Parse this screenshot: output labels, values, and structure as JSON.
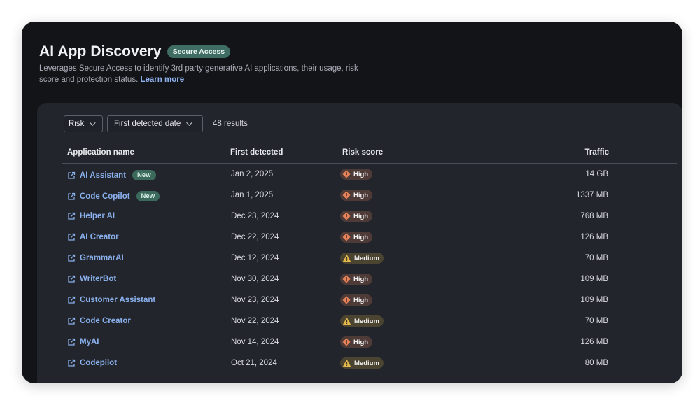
{
  "header": {
    "title": "AI App Discovery",
    "badge": "Secure Access",
    "description": "Leverages Secure Access to identify 3rd party generative AI applications, their usage, risk score and protection status.",
    "learn_more": "Learn more"
  },
  "filters": {
    "risk_label": "Risk",
    "date_label": "First detected date",
    "results": "48 results"
  },
  "table": {
    "columns": {
      "name": "Application name",
      "first_detected": "First detected",
      "risk": "Risk score",
      "traffic": "Traffic"
    },
    "rows": [
      {
        "name": "AI Assistant",
        "new": "New",
        "date": "Jan 2, 2025",
        "risk": "High",
        "traffic": "14 GB"
      },
      {
        "name": "Code Copilot",
        "new": "New",
        "date": "Jan 1, 2025",
        "risk": "High",
        "traffic": "1337 MB"
      },
      {
        "name": "Helper AI",
        "new": "",
        "date": "Dec 23, 2024",
        "risk": "High",
        "traffic": "768 MB"
      },
      {
        "name": "AI Creator",
        "new": "",
        "date": "Dec 22, 2024",
        "risk": "High",
        "traffic": "126 MB"
      },
      {
        "name": "GrammarAI",
        "new": "",
        "date": "Dec 12, 2024",
        "risk": "Medium",
        "traffic": "70 MB"
      },
      {
        "name": "WriterBot",
        "new": "",
        "date": "Nov 30, 2024",
        "risk": "High",
        "traffic": "109 MB"
      },
      {
        "name": "Customer Assistant",
        "new": "",
        "date": "Nov 23, 2024",
        "risk": "High",
        "traffic": "109 MB"
      },
      {
        "name": "Code Creator",
        "new": "",
        "date": "Nov 22, 2024",
        "risk": "Medium",
        "traffic": "70 MB"
      },
      {
        "name": "MyAI",
        "new": "",
        "date": "Nov 14, 2024",
        "risk": "High",
        "traffic": "126 MB"
      },
      {
        "name": "Codepilot",
        "new": "",
        "date": "Oct 21, 2024",
        "risk": "Medium",
        "traffic": "80 MB"
      }
    ]
  },
  "icons": {
    "link": "external-link-icon",
    "high": "alert-diamond-icon",
    "medium": "warning-triangle-icon",
    "dropdown": "chevron-down-icon"
  },
  "colors": {
    "link": "#8ab0ec",
    "high_icon": "#e8835a",
    "medium_icon": "#e3b94b",
    "new_badge": "#3b6a5c",
    "secure_badge": "#3f6d63"
  }
}
